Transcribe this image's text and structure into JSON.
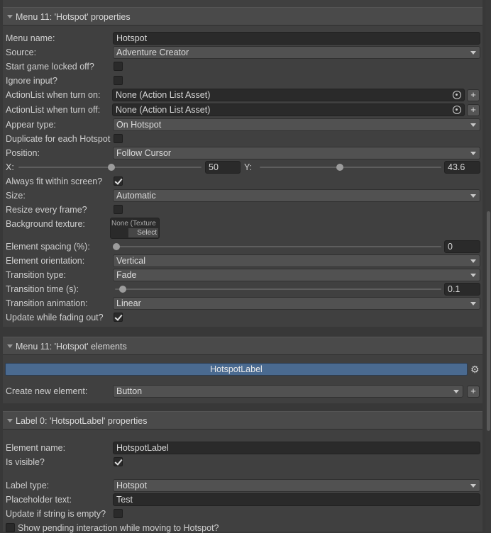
{
  "menu_properties": {
    "header": "Menu 11: 'Hotspot' properties",
    "menu_name_label": "Menu name:",
    "menu_name_value": "Hotspot",
    "source_label": "Source:",
    "source_value": "Adventure Creator",
    "start_locked_label": "Start game locked off?",
    "start_locked_checked": false,
    "ignore_input_label": "Ignore input?",
    "ignore_input_checked": false,
    "actionlist_on_label": "ActionList when turn on:",
    "actionlist_on_value": "None (Action List Asset)",
    "actionlist_off_label": "ActionList when turn off:",
    "actionlist_off_value": "None (Action List Asset)",
    "appear_type_label": "Appear type:",
    "appear_type_value": "On Hotspot",
    "duplicate_label": "Duplicate for each Hotspot",
    "duplicate_checked": false,
    "position_label": "Position:",
    "position_value": "Follow Cursor",
    "x_label": "X:",
    "x_value": "50",
    "x_fraction": 0.0,
    "y_label": "Y:",
    "y_value": "43.6",
    "always_fit_label": "Always fit within screen?",
    "always_fit_checked": true,
    "size_label": "Size:",
    "size_value": "Automatic",
    "resize_label": "Resize every frame?",
    "resize_checked": false,
    "background_label": "Background texture:",
    "background_none": "None (Texture",
    "background_select": "Select",
    "spacing_label": "Element spacing (%):",
    "spacing_value": "0",
    "orientation_label": "Element orientation:",
    "orientation_value": "Vertical",
    "transition_type_label": "Transition type:",
    "transition_type_value": "Fade",
    "transition_time_label": "Transition time (s):",
    "transition_time_value": "0.1",
    "transition_anim_label": "Transition animation:",
    "transition_anim_value": "Linear",
    "update_fading_label": "Update while fading out?",
    "update_fading_checked": true
  },
  "menu_elements": {
    "header": "Menu 11: 'Hotspot' elements",
    "element_name": "HotspotLabel",
    "create_label": "Create new element:",
    "create_value": "Button",
    "plus": "+"
  },
  "label_properties": {
    "header": "Label 0: 'HotspotLabel' properties",
    "element_name_label": "Element name:",
    "element_name_value": "HotspotLabel",
    "visible_label": "Is visible?",
    "visible_checked": true,
    "label_type_label": "Label type:",
    "label_type_value": "Hotspot",
    "placeholder_label": "Placeholder text:",
    "placeholder_value": "Test",
    "update_empty_label": "Update if string is empty?",
    "update_empty_checked": false,
    "show_pending_label": "Show pending interaction while moving to Hotspot?"
  },
  "icons": {
    "collapse": "triangle-down-icon",
    "object_picker": "object-picker-icon",
    "gear": "gear-icon",
    "checkmark": "checkmark-icon",
    "plus": "plus-icon"
  }
}
